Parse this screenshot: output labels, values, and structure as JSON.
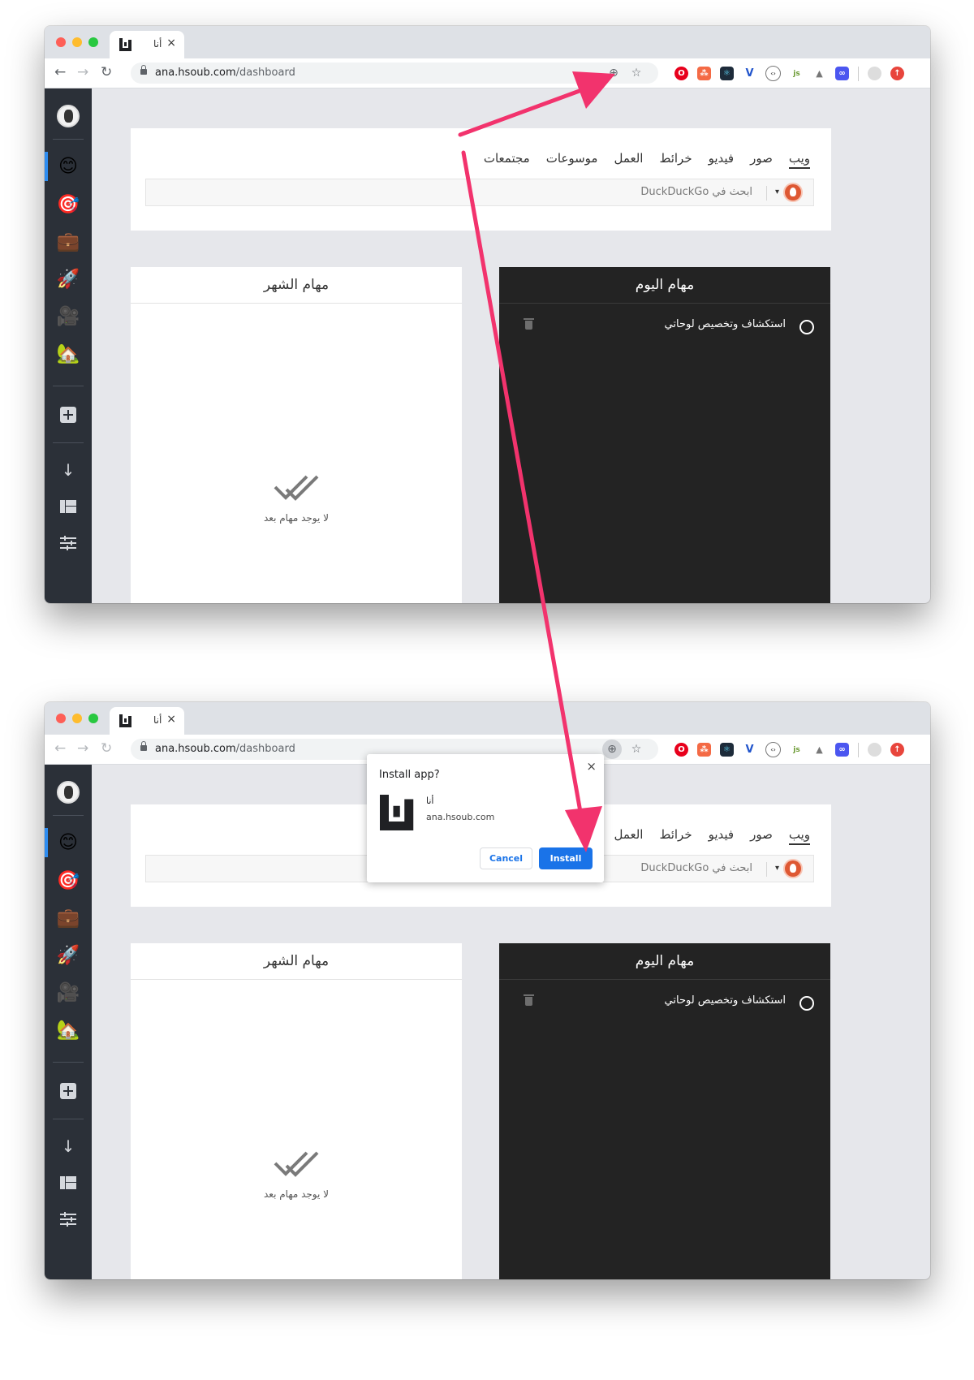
{
  "browser": {
    "tab_title": "أنا",
    "tab_close": "×",
    "url_host": "ana.hsoub.com",
    "url_path": "/dashboard"
  },
  "search": {
    "tabs": [
      "ويب",
      "صور",
      "فيديو",
      "خرائط",
      "العمل",
      "موسوعات",
      "مجتمعات"
    ],
    "placeholder": "ابحث في DuckDuckGo",
    "engine_caret": "▾"
  },
  "panels": {
    "month_title": "مهام الشهر",
    "today_title": "مهام اليوم",
    "task_text": "استكشاف وتخصيص لوحاتي",
    "empty_text": "لا يوجد مهام بعد"
  },
  "dialog": {
    "title": "Install app?",
    "close": "×",
    "app_name": "أنا",
    "app_url": "ana.hsoub.com",
    "cancel_label": "Cancel",
    "install_label": "Install"
  },
  "sidebar": {
    "icons": [
      "smiley-icon",
      "target-icon",
      "briefcase-icon",
      "rocket-icon",
      "camera-icon",
      "house-icon"
    ],
    "tools": [
      "add-icon",
      "download-icon",
      "layout-icon",
      "sliders-icon"
    ]
  },
  "colors": {
    "accent": "#1a73e8",
    "arrow": "#f2336d",
    "sidebar": "#2b3038",
    "today_panel": "#232323",
    "sidebar_active": "#2d8cf0"
  }
}
